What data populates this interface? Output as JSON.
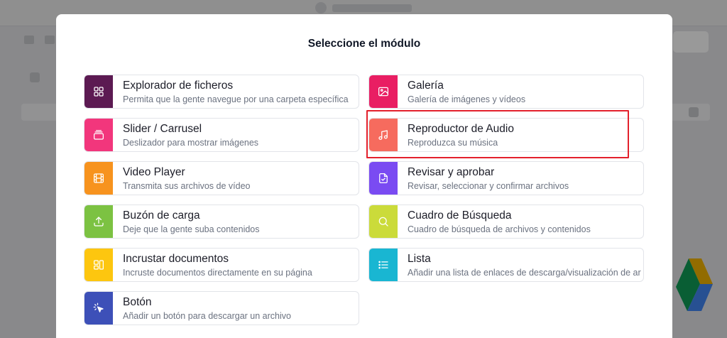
{
  "modal": {
    "title": "Seleccione el módulo"
  },
  "modules": {
    "left": [
      {
        "title": "Explorador de ficheros",
        "description": "Permita que la gente navegue por una carpeta específica",
        "icon": "grid-icon",
        "color": "#5c1a52"
      },
      {
        "title": "Slider / Carrusel",
        "description": "Deslizador para mostrar imágenes",
        "icon": "slider-icon",
        "color": "#f2367c"
      },
      {
        "title": "Video Player",
        "description": "Transmita sus archivos de vídeo",
        "icon": "film-icon",
        "color": "#f7931e"
      },
      {
        "title": "Buzón de carga",
        "description": "Deje que la gente suba contenidos",
        "icon": "upload-icon",
        "color": "#7cc242"
      },
      {
        "title": "Incrustar documentos",
        "description": "Incruste documentos directamente en su página",
        "icon": "layout-icon",
        "color": "#fdc60f"
      },
      {
        "title": "Botón",
        "description": "Añadir un botón para descargar un archivo",
        "icon": "cursor-click-icon",
        "color": "#3d50b8"
      }
    ],
    "right": [
      {
        "title": "Galería",
        "description": "Galería de imágenes y vídeos",
        "icon": "image-icon",
        "color": "#e91e63"
      },
      {
        "title": "Reproductor de Audio",
        "description": "Reproduzca su música",
        "icon": "music-note-icon",
        "color": "#f66b5e",
        "highlighted": true
      },
      {
        "title": "Revisar y aprobar",
        "description": "Revisar, seleccionar y confirmar archivos",
        "icon": "file-check-icon",
        "color": "#7a4bf2"
      },
      {
        "title": "Cuadro de Búsqueda",
        "description": "Cuadro de búsqueda de archivos y contenidos",
        "icon": "search-icon",
        "color": "#cbdb3a"
      },
      {
        "title": "Lista",
        "description": "Añadir una lista de enlaces de descarga/visualización de ar",
        "icon": "list-icon",
        "color": "#19b6d2"
      }
    ]
  },
  "highlight": {
    "color": "#e3202c"
  }
}
